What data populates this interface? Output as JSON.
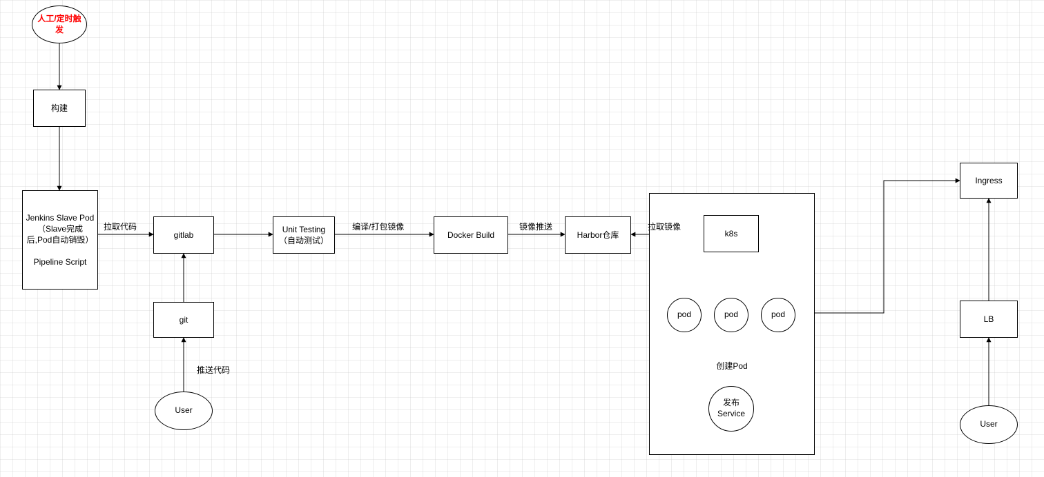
{
  "nodes": {
    "trigger": "人工/定时触发",
    "build": "构建",
    "jenkins": "Jenkins Slave Pod（Slave完成后,Pod自动销毁）\n\nPipeline Script",
    "gitlab": "gitlab",
    "git": "git",
    "userLeft": "User",
    "unit": "Unit Testing（自动测试）",
    "dockerBuild": "Docker Build",
    "harbor": "Harbor仓库",
    "k8s": "k8s",
    "pod1": "pod",
    "pod2": "pod",
    "pod3": "pod",
    "createPod": "创建Pod",
    "publishService": "发布Service",
    "ingress": "Ingress",
    "lb": "LB",
    "userRight": "User"
  },
  "edges": {
    "pullCode": "拉取代码",
    "compile": "编译/打包镜像",
    "imagePush": "镜像推送",
    "pullImage": "拉取镜像",
    "pushCode": "推送代码"
  },
  "colors": {
    "trigger": "#ff0000",
    "line": "#000000"
  }
}
